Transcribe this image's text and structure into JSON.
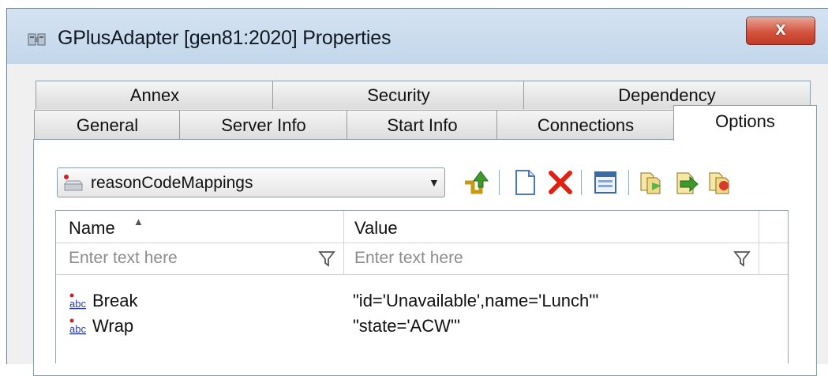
{
  "window": {
    "title": "GPlusAdapter [gen81:2020] Properties",
    "close_label": "x"
  },
  "tabs_back": [
    {
      "label": "Annex"
    },
    {
      "label": "Security"
    },
    {
      "label": "Dependency"
    }
  ],
  "tabs_front": [
    {
      "label": "General"
    },
    {
      "label": "Server Info"
    },
    {
      "label": "Start Info"
    },
    {
      "label": "Connections"
    },
    {
      "label": "Options"
    }
  ],
  "active_tab": "Options",
  "section_select": {
    "value": "reasonCodeMappings"
  },
  "toolbar": {
    "icons": [
      "up-level-icon",
      "new-document-icon",
      "delete-icon",
      "edit-icon",
      "copy-icon",
      "import-icon",
      "export-icon"
    ]
  },
  "grid": {
    "columns": [
      {
        "label": "Name"
      },
      {
        "label": "Value"
      }
    ],
    "filter_placeholder": "Enter text here",
    "rows": [
      {
        "name": "Break",
        "value": "\"id='Unavailable',name='Lunch'\""
      },
      {
        "name": "Wrap",
        "value": "\"state='ACW'\""
      }
    ]
  },
  "colors": {
    "title_bar": "#c3d6eb",
    "close_button": "#d3543f",
    "delete_red": "#e02010",
    "accent_green": "#3c9a2c"
  }
}
